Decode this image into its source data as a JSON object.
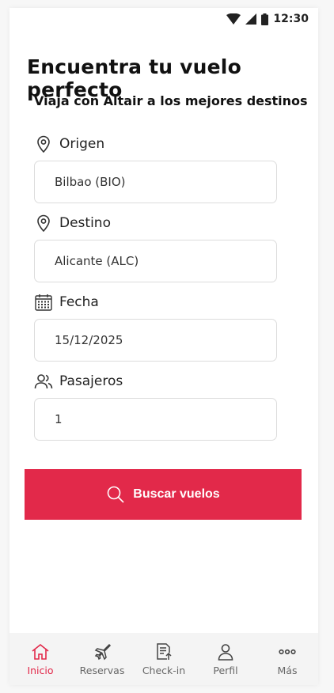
{
  "status_bar": {
    "time": "12:30"
  },
  "header": {
    "title": "Encuentra tu vuelo perfecto",
    "subtitle": "Viaja con Altair a los mejores destinos"
  },
  "form": {
    "origin": {
      "label": "Origen",
      "value": "Bilbao (BIO)",
      "icon": "location-pin-icon"
    },
    "destination": {
      "label": "Destino",
      "value": "Alicante (ALC)",
      "icon": "location-pin-icon"
    },
    "date": {
      "label": "Fecha",
      "value": "15/12/2025",
      "icon": "calendar-icon"
    },
    "passengers": {
      "label": "Pasajeros",
      "value": "1",
      "icon": "users-icon"
    }
  },
  "search_button": {
    "label": "Buscar vuelos",
    "color": "#e2294a",
    "icon": "search-icon"
  },
  "bottom_nav": {
    "items": [
      {
        "label": "Inicio",
        "icon": "home-icon",
        "active": true
      },
      {
        "label": "Reservas",
        "icon": "plane-icon",
        "active": false
      },
      {
        "label": "Check-in",
        "icon": "checkin-icon",
        "active": false
      },
      {
        "label": "Perfil",
        "icon": "profile-icon",
        "active": false
      },
      {
        "label": "Más",
        "icon": "more-icon",
        "active": false
      }
    ]
  }
}
